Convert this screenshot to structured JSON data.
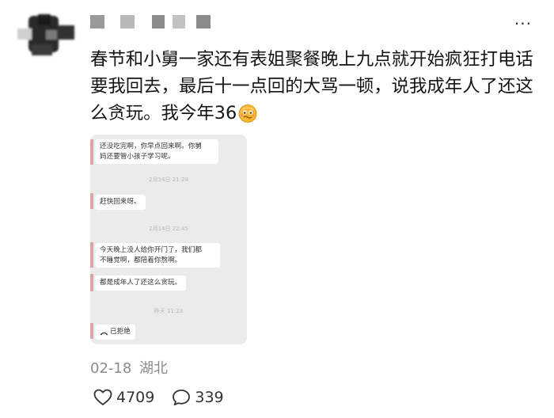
{
  "header": {
    "more_label": "···"
  },
  "post": {
    "text": "春节和小舅一家还有表姐聚餐晚上九点就开始疯狂打电话要我回去，最后十一点回的大骂一顿，说我成年人了还这么贪玩。我今年36",
    "emoji": "nervous-face-emoji"
  },
  "chat_screenshot": {
    "msg1_line1": "还没吃完啊，你早点回来啊。你舅",
    "msg1_line2": "妈还要管小孩子学习呢。",
    "ts1": "2月14日 21:24",
    "msg2": "赶快回来呀。",
    "ts2": "2月14日 22:45",
    "msg3_line1": "今天晚上没人给你开门了，我们都",
    "msg3_line2": "不睡觉啊，都陪着你熬啊。",
    "msg4": "都是成年人了还这么贪玩。",
    "ts3": "昨天 11:23",
    "call_status": "已拒绝"
  },
  "meta": {
    "date": "02-18",
    "location": "湖北"
  },
  "actions": {
    "likes": "4709",
    "comments": "339"
  },
  "colors": {
    "accent_emoji": "#f5b431",
    "text_secondary": "#8b8b8b"
  }
}
